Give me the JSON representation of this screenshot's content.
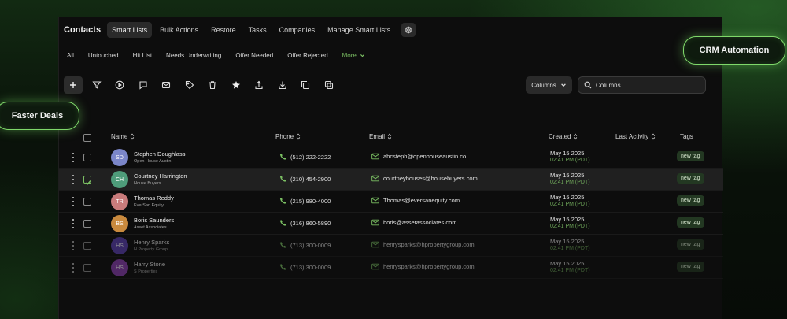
{
  "app": {
    "title": "Contacts",
    "nav_tabs": [
      "Smart Lists",
      "Bulk Actions",
      "Restore",
      "Tasks",
      "Companies",
      "Manage Smart Lists"
    ]
  },
  "filters": {
    "items": [
      "All",
      "Untouched",
      "Hit List",
      "Needs Underwriting",
      "Offer Needed",
      "Offer Rejected"
    ],
    "more_label": "More"
  },
  "toolbar": {
    "columns_label": "Columns",
    "search_value": "Columns"
  },
  "table": {
    "headers": {
      "name": "Name",
      "phone": "Phone",
      "email": "Email",
      "created": "Created",
      "last_activity": "Last Activity",
      "tags": "Tags"
    },
    "rows": [
      {
        "initials": "SD",
        "name": "Stephen Doughlass",
        "company": "Open House Austin",
        "phone": "(512) 222-2222",
        "email": "abcsteph@openhouseaustin.co",
        "created_date": "May 15 2025",
        "created_time": "02:41 PM (PDT)",
        "tag": "new tag",
        "avatar_color": "#7b86c9",
        "checked": false
      },
      {
        "initials": "CH",
        "name": "Courtney Harrington",
        "company": "House Buyers",
        "phone": "(210) 454-2900",
        "email": "courtneyhouses@housebuyers.com",
        "created_date": "May 15 2025",
        "created_time": "02:41 PM (PDT)",
        "tag": "new tag",
        "avatar_color": "#4e9c7a",
        "checked": true
      },
      {
        "initials": "TR",
        "name": "Thomas Reddy",
        "company": "EverSan Equity",
        "phone": "(215) 980-4000",
        "email": "Thomas@eversanequity.com",
        "created_date": "May 15 2025",
        "created_time": "02:41 PM (PDT)",
        "tag": "new tag",
        "avatar_color": "#c97b7b",
        "checked": false
      },
      {
        "initials": "BS",
        "name": "Boris Saunders",
        "company": "Asset Associates",
        "phone": "(316) 860-5890",
        "email": "boris@assetassociates.com",
        "created_date": "May 15 2025",
        "created_time": "02:41 PM (PDT)",
        "tag": "new tag",
        "avatar_color": "#c98a3e",
        "checked": false
      },
      {
        "initials": "HS",
        "name": "Henry Sparks",
        "company": "H Property Group",
        "phone": "(713) 300-0009",
        "email": "henrysparks@hpropertygroup.com",
        "created_date": "May 15 2025",
        "created_time": "02:41 PM (PDT)",
        "tag": "new tag",
        "avatar_color": "#5a3fb0",
        "checked": false
      },
      {
        "initials": "HS",
        "name": "Harry Stone",
        "company": "S Properties",
        "phone": "(713) 300-0009",
        "email": "henrysparks@hpropertygroup.com",
        "created_date": "May 15 2025",
        "created_time": "02:41 PM (PDT)",
        "tag": "new tag",
        "avatar_color": "#8a3fb0",
        "checked": false
      }
    ]
  },
  "badges": {
    "crm": "CRM Automation",
    "faster": "Faster Deals"
  },
  "colors": {
    "accent": "#7bbf63",
    "tag_bg": "#233822",
    "badge_border": "#7fd86a"
  }
}
